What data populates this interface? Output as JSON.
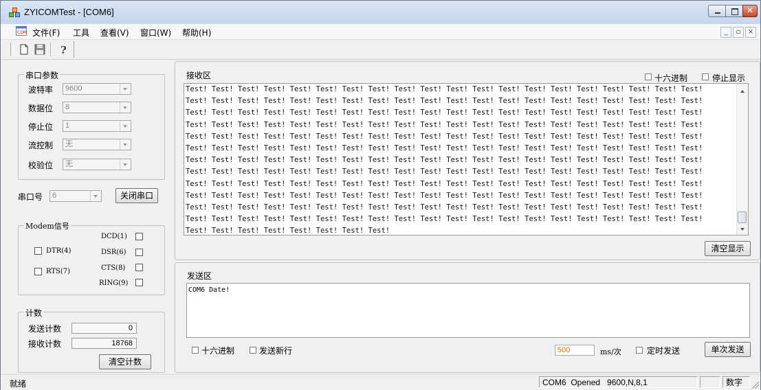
{
  "window": {
    "title": "ZYICOMTest - [COM6]"
  },
  "menubar": {
    "items": [
      "文件(F)",
      "工具",
      "查看(V)",
      "窗口(W)",
      "帮助(H)"
    ]
  },
  "serial_params": {
    "title": "串口参数",
    "rows": [
      {
        "label": "波特率",
        "value": "9600"
      },
      {
        "label": "数据位",
        "value": "8"
      },
      {
        "label": "停止位",
        "value": "1"
      },
      {
        "label": "流控制",
        "value": "无"
      },
      {
        "label": "校验位",
        "value": "无"
      }
    ]
  },
  "port": {
    "label": "串口号",
    "value": "6",
    "close_button": "关闭串口"
  },
  "modem": {
    "title": "Modem信号",
    "dtr": "DTR(4)",
    "rts": "RTS(7)",
    "dcd": "DCD(1)",
    "dsr": "DSR(6)",
    "cts": "CTS(8)",
    "ring": "RING(9)"
  },
  "counter": {
    "title": "计数",
    "send_label": "发送计数",
    "send_value": "0",
    "recv_label": "接收计数",
    "recv_value": "18768",
    "clear_button": "清空计数"
  },
  "receive": {
    "title": "接收区",
    "hex_label": "十六进制",
    "stop_label": "停止显示",
    "line_text": "Test! Test! Test! Test! Test! Test! Test! Test! Test! Test! Test! Test! Test! Test! Test! Test! Test! Test! Test! Test!",
    "last_line": "Test! Test! Test! Test! Test! Test! Test! Test!",
    "full_lines": 12,
    "clear_button": "清空显示"
  },
  "send": {
    "title": "发送区",
    "content": "COM6 Date!",
    "hex_label": "十六进制",
    "newline_label": "发送新行",
    "period_value": "500",
    "period_unit": "ms/次",
    "timed_label": "定时发送",
    "send_button": "单次发送"
  },
  "statusbar": {
    "ready": "就绪",
    "port_status": "COM6  Opened   9600,N,8,1",
    "mode": "数字"
  }
}
